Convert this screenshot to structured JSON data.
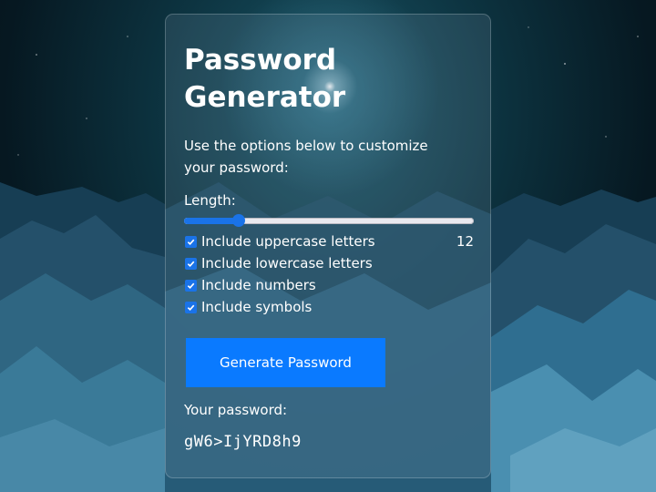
{
  "card": {
    "title": "Password Generator",
    "description": "Use the options below to customize your password:",
    "length_label": "Length:",
    "length_value": "12",
    "length_fraction": 0.19,
    "options": [
      {
        "label": "Include uppercase letters",
        "checked": true
      },
      {
        "label": "Include lowercase letters",
        "checked": true
      },
      {
        "label": "Include numbers",
        "checked": true
      },
      {
        "label": "Include symbols",
        "checked": true
      }
    ],
    "generate_label": "Generate Password",
    "password_label": "Your password:",
    "password_value": "gW6>IjYRD8h9"
  },
  "colors": {
    "accent": "#1a73e8",
    "button": "#0a7aff"
  },
  "icons": {
    "checkbox": "checkmark-icon"
  }
}
